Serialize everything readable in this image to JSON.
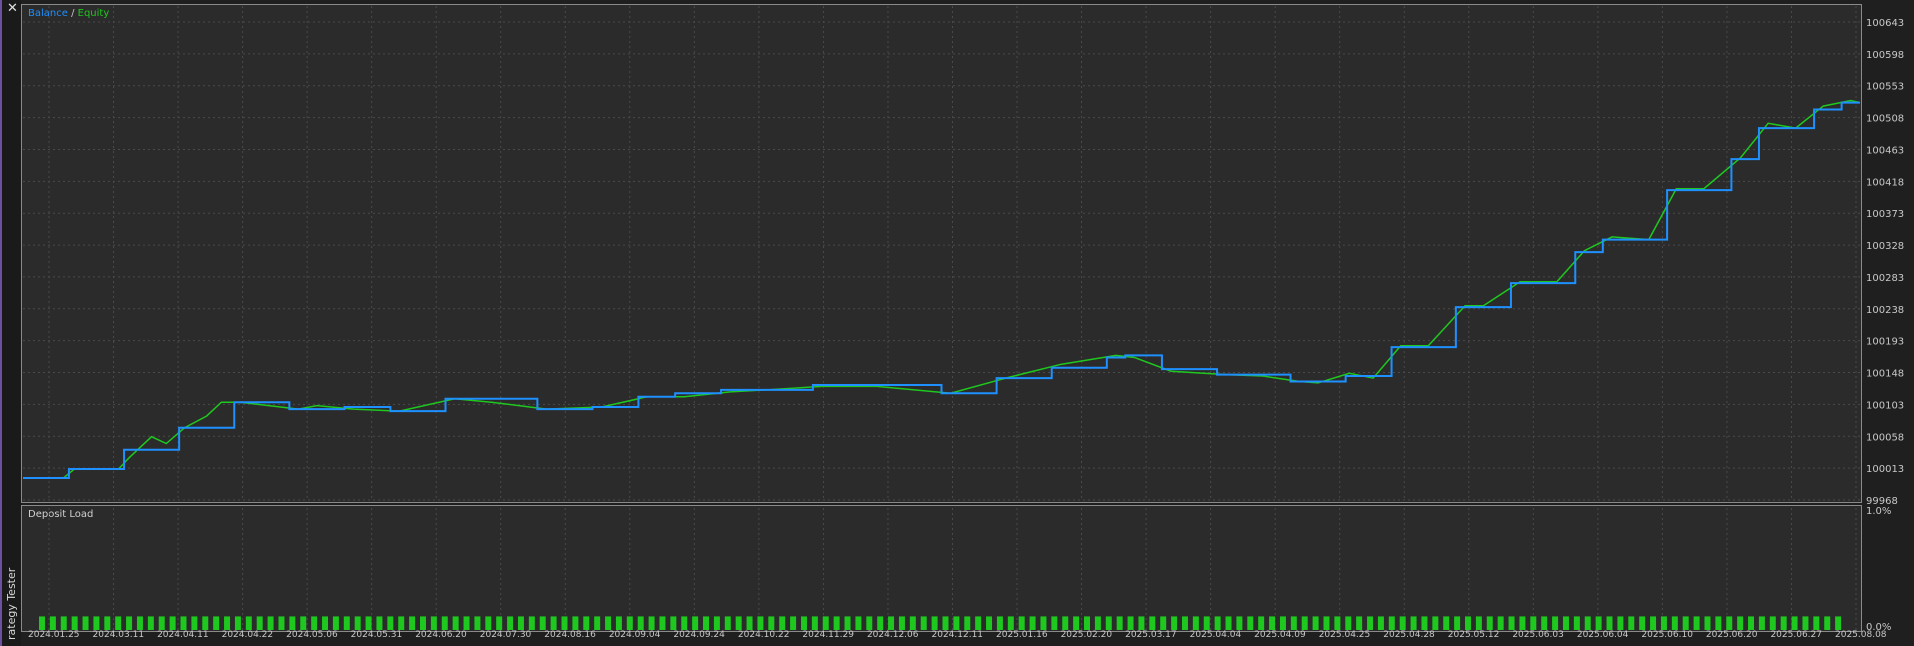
{
  "window": {
    "side_label": "rategy Tester",
    "close_glyph": "✕"
  },
  "legend": {
    "balance_label": "Balance",
    "separator": " / ",
    "equity_label": "Equity"
  },
  "subchart": {
    "title": "Deposit Load"
  },
  "colors": {
    "balance": "#1e90ff",
    "equity": "#1ec81e",
    "bars": "#1ec81e",
    "grid": "#4a4a4a",
    "background": "#2b2b2b"
  },
  "chart_data": [
    {
      "type": "line",
      "ylim": [
        99968,
        100665
      ],
      "ytick_labels": [
        "100643",
        "100598",
        "100553",
        "100508",
        "100463",
        "100418",
        "100373",
        "100328",
        "100283",
        "100238",
        "100193",
        "100148",
        "100103",
        "100058",
        "100013",
        "99968"
      ],
      "x_ticks": [
        "2024.01.25",
        "2024.03.11",
        "2024.04.11",
        "2024.04.22",
        "2024.05.06",
        "2024.05.31",
        "2024.06.20",
        "2024.07.30",
        "2024.08.16",
        "2024.09.04",
        "2024.09.24",
        "2024.10.22",
        "2024.11.29",
        "2024.12.06",
        "2024.12.11",
        "2025.01.16",
        "2025.02.20",
        "2025.03.17",
        "2025.04.04",
        "2025.04.09",
        "2025.04.25",
        "2025.04.28",
        "2025.05.12",
        "2025.06.03",
        "2025.06.04",
        "2025.06.10",
        "2025.06.20",
        "2025.06.27",
        "2025.08.08"
      ],
      "x_range": [
        0,
        1000
      ],
      "series": [
        {
          "name": "Balance",
          "x": [
            0,
            20,
            25,
            50,
            55,
            80,
            85,
            105,
            115,
            145,
            155,
            175,
            200,
            230,
            250,
            280,
            310,
            335,
            355,
            380,
            400,
            430,
            460,
            500,
            530,
            560,
            590,
            600,
            620,
            650,
            670,
            690,
            700,
            720,
            730,
            745,
            760,
            780,
            790,
            810,
            830,
            845,
            860,
            880,
            895,
            910,
            930,
            945,
            960,
            975,
            990,
            1000
          ],
          "y": [
            100000,
            100000,
            100013,
            100013,
            100041,
            100041,
            100073,
            100073,
            100110,
            100100,
            100100,
            100103,
            100097,
            100115,
            100115,
            100100,
            100103,
            100118,
            100123,
            100128,
            100128,
            100135,
            100135,
            100123,
            100145,
            100160,
            100175,
            100178,
            100158,
            100150,
            100150,
            100140,
            100140,
            100148,
            100148,
            100190,
            100190,
            100248,
            100248,
            100283,
            100283,
            100328,
            100346,
            100346,
            100418,
            100418,
            100463,
            100508,
            100508,
            100535,
            100545,
            100545
          ]
        },
        {
          "name": "Equity",
          "x": [
            0,
            22,
            28,
            52,
            58,
            70,
            78,
            88,
            100,
            108,
            118,
            150,
            160,
            180,
            205,
            235,
            255,
            285,
            315,
            340,
            360,
            385,
            405,
            435,
            465,
            505,
            535,
            565,
            595,
            605,
            625,
            655,
            675,
            695,
            705,
            722,
            735,
            750,
            765,
            785,
            795,
            815,
            835,
            850,
            865,
            885,
            900,
            915,
            935,
            950,
            965,
            980,
            995,
            1000
          ],
          "y": [
            100000,
            100000,
            100013,
            100013,
            100030,
            100060,
            100050,
            100073,
            100090,
            100110,
            100110,
            100100,
            100105,
            100100,
            100097,
            100115,
            100110,
            100100,
            100103,
            100118,
            100118,
            100125,
            100128,
            100133,
            100133,
            100123,
            100145,
            100165,
            100178,
            100175,
            100155,
            100150,
            100148,
            100140,
            100138,
            100152,
            100145,
            100192,
            100192,
            100250,
            100250,
            100285,
            100285,
            100330,
            100350,
            100346,
            100420,
            100420,
            100465,
            100515,
            100508,
            100540,
            100548,
            100545
          ]
        }
      ]
    },
    {
      "type": "bar",
      "title": "Deposit Load",
      "ylim": [
        0,
        1
      ],
      "ytick_labels": [
        "1.0%",
        "0.0%"
      ],
      "values": [
        0.16,
        0.16,
        0.16,
        0.16,
        0.16,
        0.16,
        0.16,
        0.16,
        0.16,
        0.16,
        0.16,
        0.16,
        0.16,
        0.16,
        0.16,
        0.16,
        0.16,
        0.16,
        0.16,
        0.16,
        0.16,
        0.16,
        0.16,
        0.16,
        0.16,
        0.16,
        0.16,
        0.16,
        0.16,
        0.16,
        0.16,
        0.16,
        0.16,
        0.16,
        0.16,
        0.16,
        0.16,
        0.16,
        0.16,
        0.16,
        0.16,
        0.16,
        0.16,
        0.16,
        0.16,
        0.16,
        0.16,
        0.16,
        0.16,
        0.16,
        0.16,
        0.16,
        0.16,
        0.16,
        0.16,
        0.16,
        0.16,
        0.16,
        0.16,
        0.16,
        0.16,
        0.16,
        0.16,
        0.16,
        0.16,
        0.16,
        0.16,
        0.16,
        0.16,
        0.16,
        0.16,
        0.16,
        0.16,
        0.16,
        0.16,
        0.16,
        0.16,
        0.16,
        0.16,
        0.16,
        0.16,
        0.16,
        0.16,
        0.16,
        0.16,
        0.16,
        0.16,
        0.16,
        0.16,
        0.16,
        0.16,
        0.16,
        0.16,
        0.16,
        0.16,
        0.16,
        0.16,
        0.16,
        0.16,
        0.16,
        0.16,
        0.16,
        0.16,
        0.16,
        0.16,
        0.16,
        0.16,
        0.16,
        0.16,
        0.16,
        0.16,
        0.16,
        0.16,
        0.16,
        0.16,
        0.16,
        0.16,
        0.16,
        0.16,
        0.16,
        0.16,
        0.16,
        0.16,
        0.16,
        0.16,
        0.16,
        0.16,
        0.16,
        0.16,
        0.16,
        0.16,
        0.16,
        0.16,
        0.16,
        0.16,
        0.16,
        0.16,
        0.16,
        0.16,
        0.16,
        0.16,
        0.16,
        0.16,
        0.16,
        0.16,
        0.16,
        0.16,
        0.16,
        0.16,
        0.16,
        0.16,
        0.16,
        0.16,
        0.16,
        0.16,
        0.16,
        0.16,
        0.16,
        0.16,
        0.16,
        0.16,
        0.16,
        0.16,
        0.16,
        0.16,
        0.16
      ]
    }
  ]
}
